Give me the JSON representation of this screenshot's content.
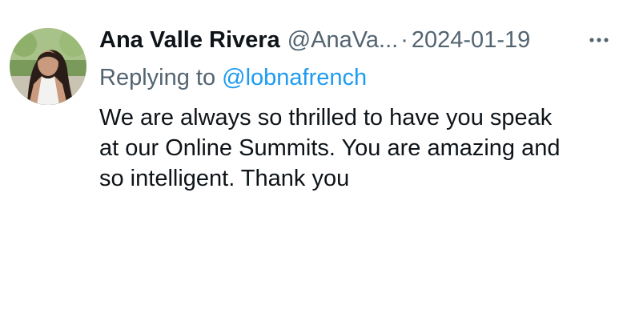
{
  "tweet": {
    "author": {
      "display_name": "Ana Valle Rivera",
      "handle": "@AnaVa...",
      "avatar_icon": "profile-photo"
    },
    "separator": "·",
    "date": "2024-01-19",
    "more_icon": "more-horizontal-icon",
    "reply": {
      "prefix": "Replying to",
      "handle": "@lobnafrench"
    },
    "body": {
      "lines": [
        "We are always so thrilled to have you speak",
        "at our Online Summits. You are amazing and",
        "so intelligent. Thank you"
      ]
    }
  },
  "colors": {
    "text_primary": "#0f1419",
    "text_secondary": "#536471",
    "link": "#1d9bf0",
    "background": "#ffffff"
  }
}
